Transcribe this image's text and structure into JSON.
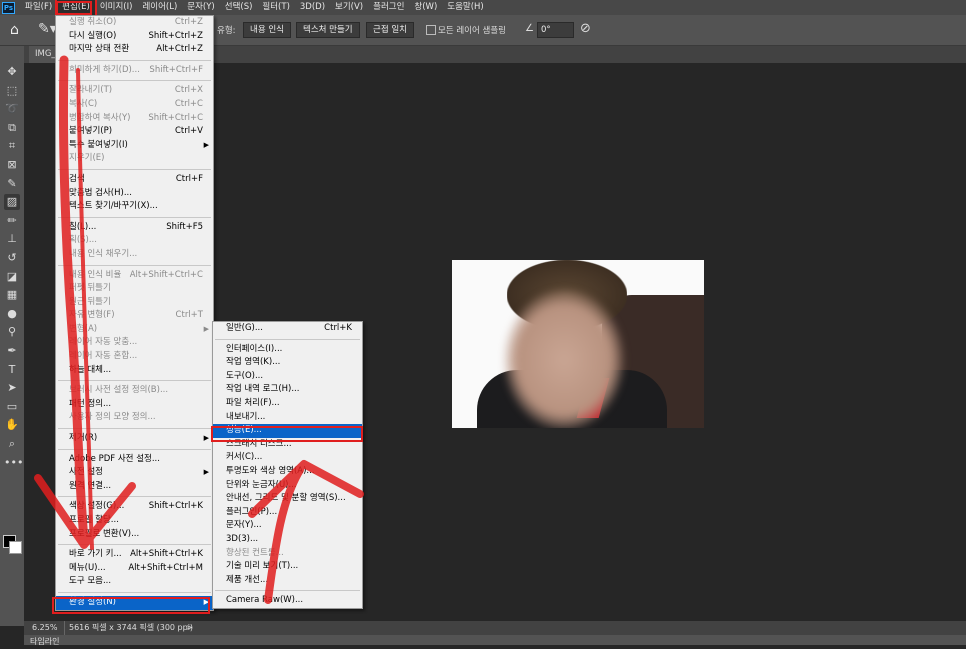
{
  "menubar": {
    "logo": "Ps",
    "items": [
      "파일(F)",
      "편집(E)",
      "이미지(I)",
      "레이어(L)",
      "문자(Y)",
      "선택(S)",
      "필터(T)",
      "3D(D)",
      "보기(V)",
      "플러그인",
      "창(W)",
      "도움말(H)"
    ],
    "active_index": 1
  },
  "options": {
    "type_label": "유형:",
    "modes": [
      "내용 인식",
      "텍스처 만들기",
      "근접 일치"
    ],
    "sample_all_layers": "모든 레이어 샘플링",
    "angle_value": "0°"
  },
  "document": {
    "tab_title": "IMG_",
    "zoom": "6.25%",
    "info": "5616 픽셀 x 3744 픽셀 (300 ppi)",
    "chevron": ">",
    "bottom_panel": "타임라인"
  },
  "edit_menu": {
    "items": [
      {
        "label": "실행 취소(O)",
        "shortcut": "Ctrl+Z",
        "disabled": true
      },
      {
        "label": "다시 실행(O)",
        "shortcut": "Shift+Ctrl+Z",
        "disabled": false
      },
      {
        "label": "마지막 상태 전환",
        "shortcut": "Alt+Ctrl+Z",
        "disabled": false
      },
      {
        "sep": true
      },
      {
        "label": "희미하게 하기(D)...",
        "shortcut": "Shift+Ctrl+F",
        "disabled": true
      },
      {
        "sep": true
      },
      {
        "label": "잘라내기(T)",
        "shortcut": "Ctrl+X",
        "disabled": true
      },
      {
        "label": "복사(C)",
        "shortcut": "Ctrl+C",
        "disabled": true
      },
      {
        "label": "병합하여 복사(Y)",
        "shortcut": "Shift+Ctrl+C",
        "disabled": true
      },
      {
        "label": "붙여넣기(P)",
        "shortcut": "Ctrl+V",
        "disabled": false
      },
      {
        "label": "특수 붙여넣기(I)",
        "shortcut": "",
        "disabled": false,
        "submenu": true
      },
      {
        "label": "지우기(E)",
        "shortcut": "",
        "disabled": true
      },
      {
        "sep": true
      },
      {
        "label": "검색",
        "shortcut": "Ctrl+F",
        "disabled": false
      },
      {
        "label": "맞춤법 검사(H)...",
        "shortcut": "",
        "disabled": false
      },
      {
        "label": "텍스트 찾기/바꾸기(X)...",
        "shortcut": "",
        "disabled": false
      },
      {
        "sep": true
      },
      {
        "label": "칠(L)...",
        "shortcut": "Shift+F5",
        "disabled": false
      },
      {
        "label": "획(S)...",
        "shortcut": "",
        "disabled": true
      },
      {
        "label": "내용 인식 채우기...",
        "shortcut": "",
        "disabled": true
      },
      {
        "sep": true
      },
      {
        "label": "내용 인식 비율",
        "shortcut": "Alt+Shift+Ctrl+C",
        "disabled": true
      },
      {
        "label": "퍼펫 뒤틀기",
        "shortcut": "",
        "disabled": true
      },
      {
        "label": "원근 뒤틀기",
        "shortcut": "",
        "disabled": true
      },
      {
        "label": "자유 변형(F)",
        "shortcut": "Ctrl+T",
        "disabled": true
      },
      {
        "label": "변형(A)",
        "shortcut": "",
        "disabled": true,
        "submenu": true
      },
      {
        "label": "레이어 자동 맞춤...",
        "shortcut": "",
        "disabled": true
      },
      {
        "label": "레이어 자동 혼합...",
        "shortcut": "",
        "disabled": true
      },
      {
        "label": "하늘 대체...",
        "shortcut": "",
        "disabled": false
      },
      {
        "sep": true
      },
      {
        "label": "브러시 사전 설정 정의(B)...",
        "shortcut": "",
        "disabled": true
      },
      {
        "label": "패턴 정의...",
        "shortcut": "",
        "disabled": false
      },
      {
        "label": "사용자 정의 모양 정의...",
        "shortcut": "",
        "disabled": true
      },
      {
        "sep": true
      },
      {
        "label": "제거(R)",
        "shortcut": "",
        "disabled": false,
        "submenu": true
      },
      {
        "sep": true
      },
      {
        "label": "Adobe PDF 사전 설정...",
        "shortcut": "",
        "disabled": false
      },
      {
        "label": "사전 설정",
        "shortcut": "",
        "disabled": false,
        "submenu": true
      },
      {
        "label": "원격 연결...",
        "shortcut": "",
        "disabled": false
      },
      {
        "sep": true
      },
      {
        "label": "색상 설정(G)...",
        "shortcut": "Shift+Ctrl+K",
        "disabled": false
      },
      {
        "label": "프로필 할당...",
        "shortcut": "",
        "disabled": false
      },
      {
        "label": "프로필로 변환(V)...",
        "shortcut": "",
        "disabled": false
      },
      {
        "sep": true
      },
      {
        "label": "바로 가기 키...",
        "shortcut": "Alt+Shift+Ctrl+K",
        "disabled": false
      },
      {
        "label": "메뉴(U)...",
        "shortcut": "Alt+Shift+Ctrl+M",
        "disabled": false
      },
      {
        "label": "도구 모음...",
        "shortcut": "",
        "disabled": false
      },
      {
        "sep": true
      },
      {
        "label": "환경 설정(N)",
        "shortcut": "",
        "disabled": false,
        "submenu": true,
        "highlight": true
      }
    ]
  },
  "pref_menu": {
    "items": [
      {
        "label": "일반(G)...",
        "shortcut": "Ctrl+K",
        "disabled": false
      },
      {
        "sep": true
      },
      {
        "label": "인터페이스(I)...",
        "shortcut": "",
        "disabled": false
      },
      {
        "label": "작업 영역(K)...",
        "shortcut": "",
        "disabled": false
      },
      {
        "label": "도구(O)...",
        "shortcut": "",
        "disabled": false
      },
      {
        "label": "작업 내역 로그(H)...",
        "shortcut": "",
        "disabled": false
      },
      {
        "label": "파일 처리(F)...",
        "shortcut": "",
        "disabled": false
      },
      {
        "label": "내보내기...",
        "shortcut": "",
        "disabled": false
      },
      {
        "label": "성능(E)...",
        "shortcut": "",
        "disabled": false,
        "highlight": true
      },
      {
        "label": "스크래치 디스크...",
        "shortcut": "",
        "disabled": false
      },
      {
        "label": "커서(C)...",
        "shortcut": "",
        "disabled": false
      },
      {
        "label": "투명도와 색상 영역(A)...",
        "shortcut": "",
        "disabled": false
      },
      {
        "label": "단위와 눈금자(U)...",
        "shortcut": "",
        "disabled": false
      },
      {
        "label": "안내선, 그리드 및 분할 영역(S)...",
        "shortcut": "",
        "disabled": false
      },
      {
        "label": "플러그인(P)...",
        "shortcut": "",
        "disabled": false
      },
      {
        "label": "문자(Y)...",
        "shortcut": "",
        "disabled": false
      },
      {
        "label": "3D(3)...",
        "shortcut": "",
        "disabled": false
      },
      {
        "label": "향상된 컨트롤...",
        "shortcut": "",
        "disabled": true
      },
      {
        "label": "기술 미리 보기(T)...",
        "shortcut": "",
        "disabled": false
      },
      {
        "label": "제품 개선...",
        "shortcut": "",
        "disabled": false
      },
      {
        "sep": true
      },
      {
        "label": "Camera Raw(W)...",
        "shortcut": "",
        "disabled": false
      }
    ]
  },
  "toolbar": {
    "tools": [
      "move-icon",
      "marquee-icon",
      "lasso-icon",
      "object-select-icon",
      "crop-icon",
      "frame-icon",
      "eyedropper-icon",
      "healing-brush-icon",
      "brush-icon",
      "stamp-icon",
      "history-brush-icon",
      "eraser-icon",
      "gradient-icon",
      "blur-icon",
      "dodge-icon",
      "pen-icon",
      "type-icon",
      "path-select-icon",
      "rectangle-icon",
      "hand-icon",
      "zoom-icon",
      "more-icon"
    ],
    "glyphs": [
      "✥",
      "⬚",
      "➰",
      "⧉",
      "⌗",
      "⊠",
      "✎",
      "▨",
      "✏",
      "⊥",
      "↺",
      "◪",
      "▦",
      "●",
      "⚲",
      "✒",
      "T",
      "➤",
      "▭",
      "✋",
      "⌕",
      "•••"
    ],
    "selected_index": 7
  },
  "colors": {
    "accent": "#0a64c8",
    "annotation_red": "#e01e1e"
  }
}
